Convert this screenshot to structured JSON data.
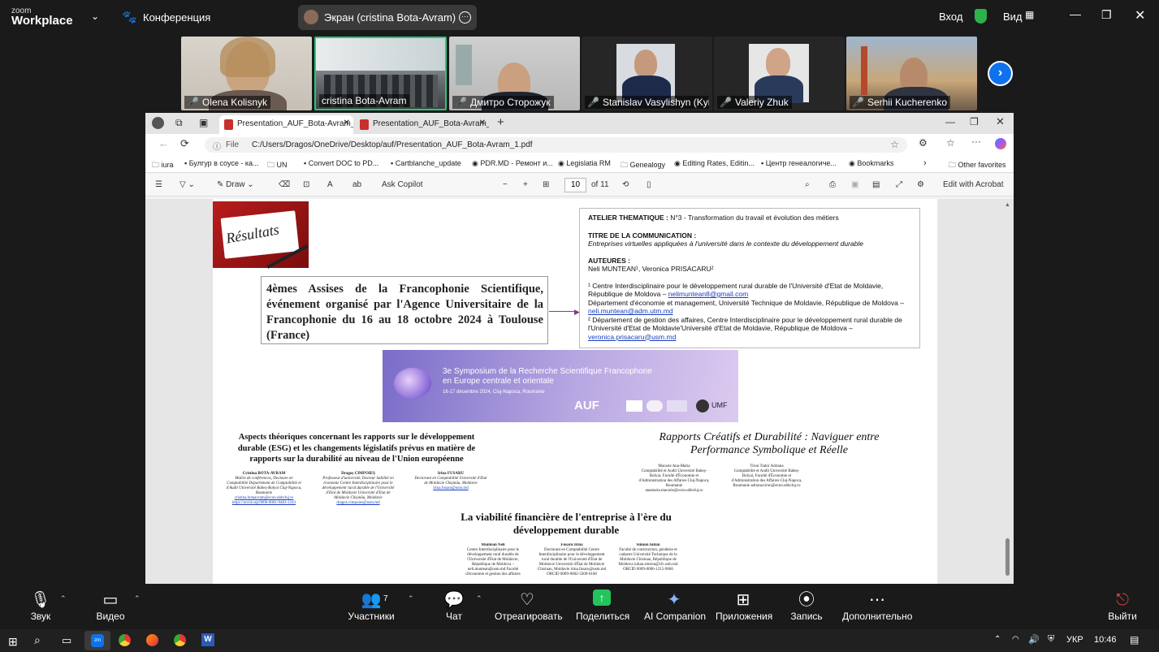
{
  "zoom": {
    "logo_line1": "zoom",
    "logo_line2": "Workplace",
    "conference_label": "Конференция",
    "screen_share_label": "Экран (cristina Bota-Avram)",
    "enter_label": "Вход",
    "view_label": "Вид",
    "participants": [
      {
        "name": "Olena Kolisnyk"
      },
      {
        "name": "cristina Bota-Avram"
      },
      {
        "name": "Дмитро Сторожук"
      },
      {
        "name": "Stanislav Vasylishyn (Kyiv,..."
      },
      {
        "name": "Valeriy Zhuk"
      },
      {
        "name": "Serhii Kucherenko"
      }
    ],
    "bottom": {
      "audio": "Звук",
      "video": "Видео",
      "participants": "Участники",
      "participants_count": "7",
      "chat": "Чат",
      "react": "Отреагировать",
      "share": "Поделиться",
      "ai": "AI Companion",
      "apps": "Приложения",
      "record": "Запись",
      "more": "Дополнительно",
      "leave": "Выйти"
    }
  },
  "browser": {
    "tabs": [
      "Presentation_AUF_Bota-Avram_1.p",
      "Presentation_AUF_Bota-Avram_2.p"
    ],
    "address_prefix": "File",
    "address": "C:/Users/Dragos/OneDrive/Desktop/auf/Presentation_AUF_Bota-Avram_1.pdf",
    "bookmarks": [
      "iura",
      "Булгур в соусе - ка...",
      "UN",
      "Convert DOC to PD...",
      "Cartblanche_update",
      "PDR.MD - Ремонт и...",
      "Legislatia RM",
      "Genealogy",
      "Editing Rates, Editin...",
      "Центр генеалогиче...",
      "Bookmarks"
    ],
    "other_favorites": "Other favorites",
    "pdf_toolbar": {
      "draw": "Draw",
      "copilot": "Ask Copilot",
      "page": "10",
      "of": "of 11",
      "edit": "Edit with Acrobat"
    }
  },
  "slide": {
    "badge": "Résultats",
    "assises": "4èmes Assises de la Francophonie Scientifique, événement organisé par l'Agence Universitaire de la Francophonie du 16 au 18 octobre 2024 à Toulouse (France)",
    "atelier_label": "ATELIER THEMATIQUE :",
    "atelier_text": " N°3 - Transformation du travail et évolution des métiers",
    "titre_label": "TITRE DE LA COMMUNICATION :",
    "titre_text": "Entreprises virtuelles appliquées à l'université dans le contexte du développement durable",
    "auteurs_label": "AUTEURES :",
    "auteurs_text": "Neli MUNTEAN¹, Veronica PRISACARU²",
    "aff1": "¹ Centre Interdisciplinaire pour le développement rural durable de l'Université d'Etat de Moldavie, République de Moldova –",
    "email1": "nelimuntean8@gmail.com",
    "aff1b": "Département d'économie et management, Université Technique de Moldavie, République de Moldova –",
    "email1b": "neli.muntean@adm.utm.md",
    "aff2": "² Département de gestion des affaires, Centre Interdisciplinaire pour le développement rural durable de l'Université d'Etat de Moldavie'Université d'Etat de Moldavie, République de Moldova –",
    "email2": "veronica.prisacaru@usm.md",
    "banner_line1": "3e Symposium de la Recherche Scientifique Francophone",
    "banner_line2": "en Europe centrale et orientale",
    "banner_date": "16-17 décembre 2024, Cluj-Napoca, Roumanie",
    "banner_logo": "AUF",
    "banner_umf": "UMF",
    "paper1_title": "Aspects théoriques concernant les rapports sur le développement durable (ESG) et les changements législatifs prévus en matière de rapports sur la durabilité au niveau de l'Union européenne",
    "paper1_authors": [
      {
        "name": "Cristina BOTA-AVRAM",
        "text": "Maître de conférences, Docteure en Comptabilité Département de Comptabilité et d'Audit Université Babeș-Bolyai Cluj-Napoca, Roumanie",
        "link": "cristina.botaavram@econ.ubbcluj.ro https://orcid.org/0000-0001-9483-1243"
      },
      {
        "name": "Dragoș CIMPOIEȘ",
        "text": "Professeur d'université, Docteur habilité en économie Centre Interdisciplinaire pour le développement rural durable de l'Université d'Etat de Moldavie Université d'Etat de Moldavie Chișinău, Moldavie",
        "link": "dragos.cimpoies@usm.md"
      },
      {
        "name": "Irina FUSARU",
        "text": "Doctorant en Comptabilité Université d'Etat de Moldavie Chișinău, Moldavie",
        "link": "irina.fusaru@usm.md"
      }
    ],
    "paper2_title": "Rapports Créatifs et Durabilité : Naviguer entre Performance Symbolique et Réelle",
    "paper2_authors": [
      {
        "name": "Macarie Ana-Maria",
        "text": "Comptabilité et Audit Université Babeș-Bolyai, Faculté d'Économie et d'Administration des Affaires Cluj-Napoca, Roumanie anamaria.macarie@econ.ubbcluj.ro"
      },
      {
        "name": "Tiron Tudor Adriana",
        "text": "Comptabilité et Audit Université Babeș-Bolyai, Faculté d'Économie et d'Administration des Affaires Cluj-Napoca, Roumanie adriana.tiron@econ.ubbcluj.ro"
      }
    ],
    "paper3_title": "La viabilité financière de l'entreprise à l'ère du développement durable",
    "paper3_authors": [
      {
        "name": "Muntean Neli",
        "text": "Centre Interdisciplinaire pour le développement rural durable de l'Université d'État de Moldavie, République de Moldova – neli.muntean@usm.md Faculté d'économie et gestion des affaires"
      },
      {
        "name": "Fusaru Irina",
        "text": "Doctorant en Comptabilité Centre Interdisciplinaire pour le développement rural durable de l'Université d'État de Moldavie Université d'État de Moldavie Chisinau, Moldavie irina.fusaru@usm.md ORCID 0009-0002-3309-6160"
      },
      {
        "name": "Simion Iulian",
        "text": "Faculté de construction, géodésie et cadastre Université Technique de la Moldavie Chisinau, République de Moldova iulian.simion@cfc.utm.md ORCID 0009-0006-1215-9666"
      }
    ]
  },
  "taskbar": {
    "lang": "УКР",
    "time": "10:46"
  }
}
